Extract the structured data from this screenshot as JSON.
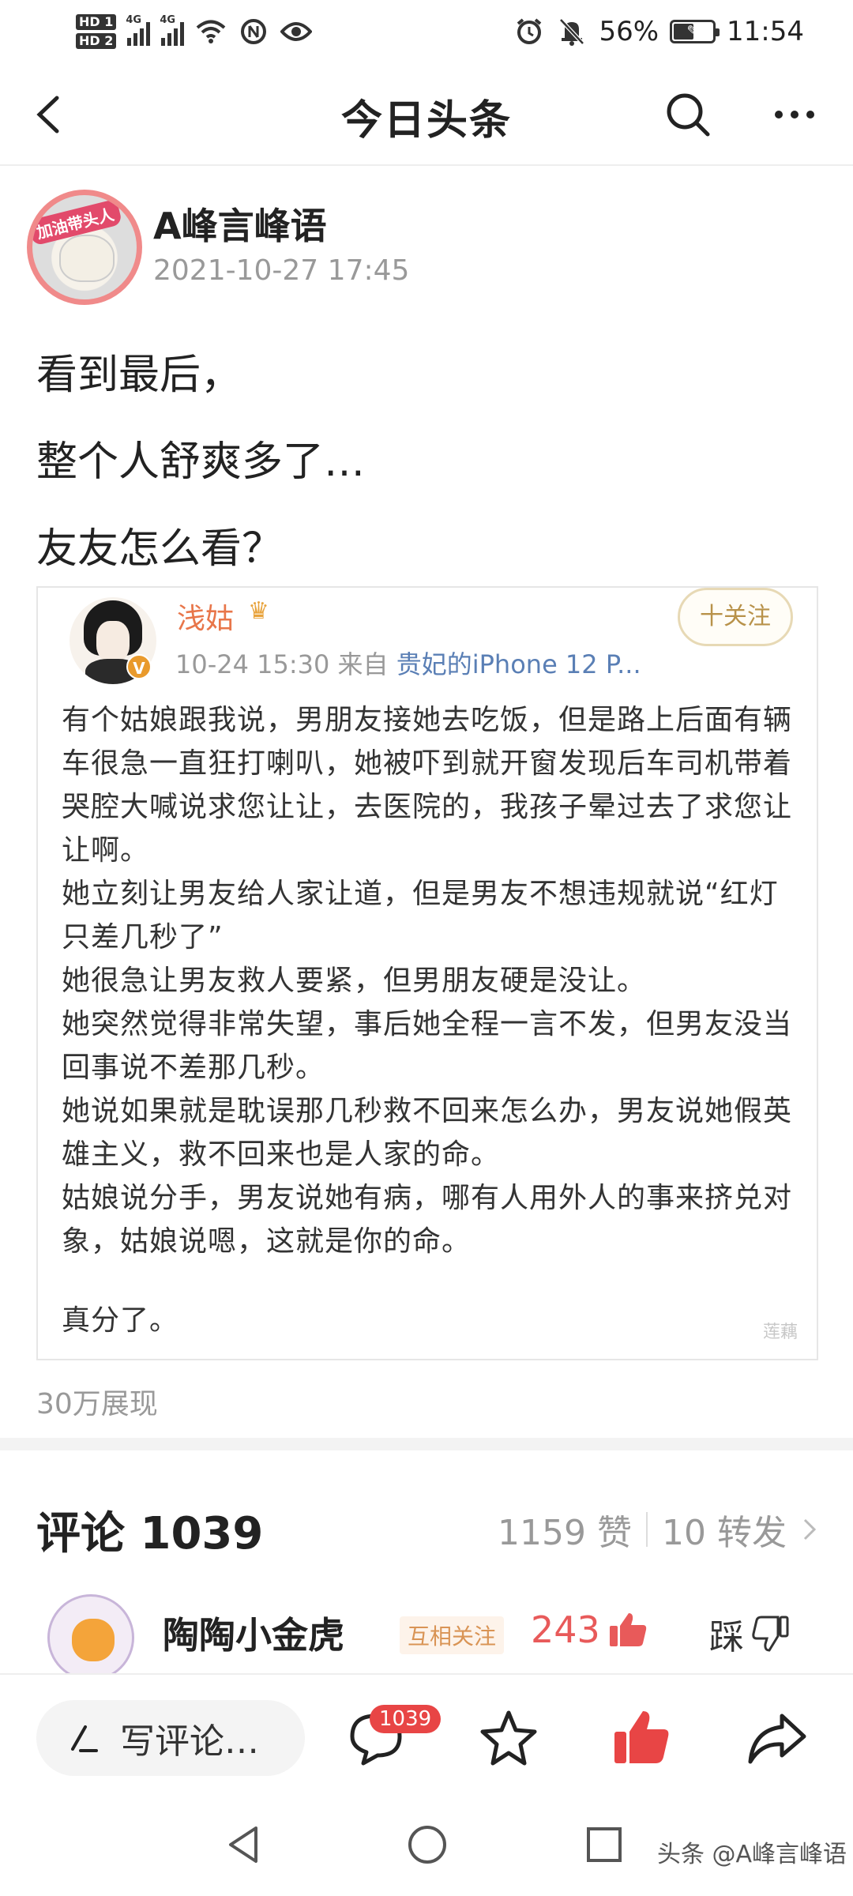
{
  "status_bar": {
    "hd1": "HD 1",
    "hd2": "HD 2",
    "net1": "4G",
    "net2": "4G",
    "battery_percent": "56%",
    "battery_level": 0.56,
    "time": "11:54",
    "icons": [
      "wifi-icon",
      "nfc-icon",
      "eye-icon",
      "alarm-icon",
      "mute-icon",
      "battery-icon"
    ]
  },
  "header": {
    "title": "今日头条"
  },
  "author": {
    "name": "A峰言峰语",
    "time": "2021-10-27 17:45",
    "avatar_badge": "加油带头人"
  },
  "post": {
    "lines": [
      "看到最后，",
      "整个人舒爽多了…",
      "友友怎么看？"
    ]
  },
  "embed": {
    "name": "浅姑",
    "meta_time": "10-24 15:30",
    "meta_from": "来自",
    "meta_source": "贵妃的iPhone 12 P...",
    "follow_label": "十关注",
    "v_badge": "V",
    "paragraphs": [
      "有个姑娘跟我说，男朋友接她去吃饭，但是路上后面有辆车很急一直狂打喇叭，她被吓到就开窗发现后车司机带着哭腔大喊说求您让让，去医院的，我孩子晕过去了求您让让啊。",
      "她立刻让男友给人家让道，但是男友不想违规就说“红灯只差几秒了”",
      "她很急让男友救人要紧，但男朋友硬是没让。",
      "她突然觉得非常失望，事后她全程一言不发，但男友没当回事说不差那几秒。",
      "她说如果就是耽误那几秒救不回来怎么办，男友说她假英雄主义，救不回来也是人家的命。",
      "姑娘说分手，男友说她有病，哪有人用外人的事来挤兑对象，姑娘说嗯，这就是你的命。",
      "真分了。"
    ],
    "watermark": "莲藕"
  },
  "views": "30万展现",
  "comments": {
    "title": "评论 1039",
    "likes": "1159 赞",
    "shares": "10 转发",
    "first": {
      "name": "陶陶小金虎",
      "tag": "互相关注",
      "like_count": "243",
      "dislike_label": "踩"
    }
  },
  "action_bar": {
    "compose_label": "写评论…",
    "comment_badge": "1039"
  },
  "system_nav": {
    "watermark": "头条 @A峰言峰语"
  },
  "colors": {
    "accent_red": "#e84545",
    "like_red": "#e85a5a",
    "follow_gold": "#b8924a",
    "embed_name": "#e8764a"
  }
}
